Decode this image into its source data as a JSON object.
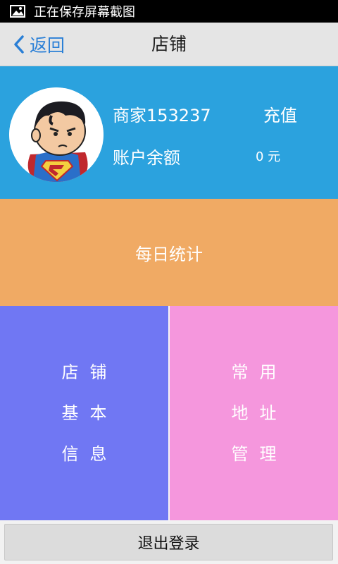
{
  "status_bar": {
    "icon": "image-icon",
    "text": "正在保存屏幕截图"
  },
  "title_bar": {
    "back_label": "返回",
    "title": "店铺"
  },
  "profile": {
    "merchant_name": "商家153237",
    "recharge_label": "充值",
    "balance_label": "账户余额",
    "balance_value": "0 元"
  },
  "daily_stats_label": "每日统计",
  "tiles": {
    "left": {
      "lines": [
        "店铺",
        "基本",
        "信息"
      ]
    },
    "right": {
      "lines": [
        "常用",
        "地址",
        "管理"
      ]
    }
  },
  "logout_label": "退出登录",
  "colors": {
    "header": "#2ba2de",
    "daily": "#f0aa64",
    "tile_left": "#7077f3",
    "tile_right": "#f597dd",
    "back_link": "#2a7fd6"
  }
}
